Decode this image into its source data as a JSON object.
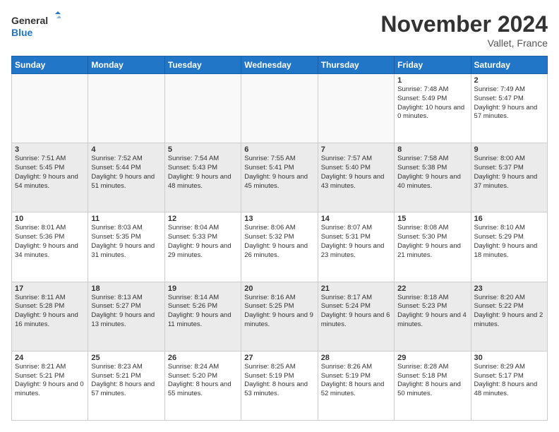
{
  "logo": {
    "line1": "General",
    "line2": "Blue"
  },
  "title": "November 2024",
  "location": "Vallet, France",
  "weekdays": [
    "Sunday",
    "Monday",
    "Tuesday",
    "Wednesday",
    "Thursday",
    "Friday",
    "Saturday"
  ],
  "rows": [
    [
      {
        "day": "",
        "info": ""
      },
      {
        "day": "",
        "info": ""
      },
      {
        "day": "",
        "info": ""
      },
      {
        "day": "",
        "info": ""
      },
      {
        "day": "",
        "info": ""
      },
      {
        "day": "1",
        "info": "Sunrise: 7:48 AM\nSunset: 5:49 PM\nDaylight: 10 hours and 0 minutes."
      },
      {
        "day": "2",
        "info": "Sunrise: 7:49 AM\nSunset: 5:47 PM\nDaylight: 9 hours and 57 minutes."
      }
    ],
    [
      {
        "day": "3",
        "info": "Sunrise: 7:51 AM\nSunset: 5:45 PM\nDaylight: 9 hours and 54 minutes."
      },
      {
        "day": "4",
        "info": "Sunrise: 7:52 AM\nSunset: 5:44 PM\nDaylight: 9 hours and 51 minutes."
      },
      {
        "day": "5",
        "info": "Sunrise: 7:54 AM\nSunset: 5:43 PM\nDaylight: 9 hours and 48 minutes."
      },
      {
        "day": "6",
        "info": "Sunrise: 7:55 AM\nSunset: 5:41 PM\nDaylight: 9 hours and 45 minutes."
      },
      {
        "day": "7",
        "info": "Sunrise: 7:57 AM\nSunset: 5:40 PM\nDaylight: 9 hours and 43 minutes."
      },
      {
        "day": "8",
        "info": "Sunrise: 7:58 AM\nSunset: 5:38 PM\nDaylight: 9 hours and 40 minutes."
      },
      {
        "day": "9",
        "info": "Sunrise: 8:00 AM\nSunset: 5:37 PM\nDaylight: 9 hours and 37 minutes."
      }
    ],
    [
      {
        "day": "10",
        "info": "Sunrise: 8:01 AM\nSunset: 5:36 PM\nDaylight: 9 hours and 34 minutes."
      },
      {
        "day": "11",
        "info": "Sunrise: 8:03 AM\nSunset: 5:35 PM\nDaylight: 9 hours and 31 minutes."
      },
      {
        "day": "12",
        "info": "Sunrise: 8:04 AM\nSunset: 5:33 PM\nDaylight: 9 hours and 29 minutes."
      },
      {
        "day": "13",
        "info": "Sunrise: 8:06 AM\nSunset: 5:32 PM\nDaylight: 9 hours and 26 minutes."
      },
      {
        "day": "14",
        "info": "Sunrise: 8:07 AM\nSunset: 5:31 PM\nDaylight: 9 hours and 23 minutes."
      },
      {
        "day": "15",
        "info": "Sunrise: 8:08 AM\nSunset: 5:30 PM\nDaylight: 9 hours and 21 minutes."
      },
      {
        "day": "16",
        "info": "Sunrise: 8:10 AM\nSunset: 5:29 PM\nDaylight: 9 hours and 18 minutes."
      }
    ],
    [
      {
        "day": "17",
        "info": "Sunrise: 8:11 AM\nSunset: 5:28 PM\nDaylight: 9 hours and 16 minutes."
      },
      {
        "day": "18",
        "info": "Sunrise: 8:13 AM\nSunset: 5:27 PM\nDaylight: 9 hours and 13 minutes."
      },
      {
        "day": "19",
        "info": "Sunrise: 8:14 AM\nSunset: 5:26 PM\nDaylight: 9 hours and 11 minutes."
      },
      {
        "day": "20",
        "info": "Sunrise: 8:16 AM\nSunset: 5:25 PM\nDaylight: 9 hours and 9 minutes."
      },
      {
        "day": "21",
        "info": "Sunrise: 8:17 AM\nSunset: 5:24 PM\nDaylight: 9 hours and 6 minutes."
      },
      {
        "day": "22",
        "info": "Sunrise: 8:18 AM\nSunset: 5:23 PM\nDaylight: 9 hours and 4 minutes."
      },
      {
        "day": "23",
        "info": "Sunrise: 8:20 AM\nSunset: 5:22 PM\nDaylight: 9 hours and 2 minutes."
      }
    ],
    [
      {
        "day": "24",
        "info": "Sunrise: 8:21 AM\nSunset: 5:21 PM\nDaylight: 9 hours and 0 minutes."
      },
      {
        "day": "25",
        "info": "Sunrise: 8:23 AM\nSunset: 5:21 PM\nDaylight: 8 hours and 57 minutes."
      },
      {
        "day": "26",
        "info": "Sunrise: 8:24 AM\nSunset: 5:20 PM\nDaylight: 8 hours and 55 minutes."
      },
      {
        "day": "27",
        "info": "Sunrise: 8:25 AM\nSunset: 5:19 PM\nDaylight: 8 hours and 53 minutes."
      },
      {
        "day": "28",
        "info": "Sunrise: 8:26 AM\nSunset: 5:19 PM\nDaylight: 8 hours and 52 minutes."
      },
      {
        "day": "29",
        "info": "Sunrise: 8:28 AM\nSunset: 5:18 PM\nDaylight: 8 hours and 50 minutes."
      },
      {
        "day": "30",
        "info": "Sunrise: 8:29 AM\nSunset: 5:17 PM\nDaylight: 8 hours and 48 minutes."
      }
    ]
  ]
}
